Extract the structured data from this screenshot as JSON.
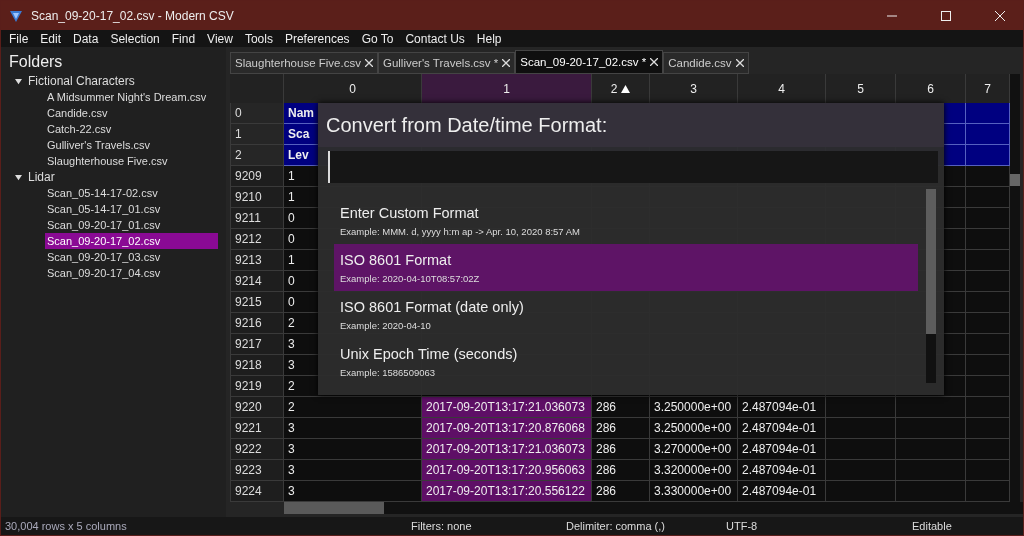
{
  "window": {
    "title": "Scan_09-20-17_02.csv - Modern CSV"
  },
  "menu": [
    "File",
    "Edit",
    "Data",
    "Selection",
    "Find",
    "View",
    "Tools",
    "Preferences",
    "Go To",
    "Contact Us",
    "Help"
  ],
  "sidebar": {
    "title": "Folders",
    "items": [
      {
        "label": "Fictional Characters",
        "expanded": true,
        "selected": false,
        "children": [
          {
            "label": "A Midsummer Night's Dream.csv",
            "selected": false
          },
          {
            "label": "Candide.csv",
            "selected": false
          },
          {
            "label": "Catch-22.csv",
            "selected": false
          },
          {
            "label": "Gulliver's Travels.csv",
            "selected": false
          },
          {
            "label": "Slaughterhouse Five.csv",
            "selected": false
          }
        ]
      },
      {
        "label": "Lidar",
        "expanded": true,
        "selected": false,
        "children": [
          {
            "label": "Scan_05-14-17-02.csv",
            "selected": false
          },
          {
            "label": "Scan_05-14-17_01.csv",
            "selected": false
          },
          {
            "label": "Scan_09-20-17_01.csv",
            "selected": false
          },
          {
            "label": "Scan_09-20-17_02.csv",
            "selected": true
          },
          {
            "label": "Scan_09-20-17_03.csv",
            "selected": false
          },
          {
            "label": "Scan_09-20-17_04.csv",
            "selected": false
          }
        ]
      }
    ]
  },
  "tabs": [
    {
      "label": "Slaughterhouse Five.csv",
      "selected": false
    },
    {
      "label": "Gulliver's Travels.csv *",
      "selected": false
    },
    {
      "label": "Scan_09-20-17_02.csv *",
      "selected": true
    },
    {
      "label": "Candide.csv",
      "selected": false
    }
  ],
  "table": {
    "columns": [
      {
        "label": "0",
        "sorted": false,
        "selected": false
      },
      {
        "label": "1",
        "sorted": false,
        "selected": true
      },
      {
        "label": "2",
        "sorted": true,
        "selected": false
      },
      {
        "label": "3",
        "sorted": false,
        "selected": false
      },
      {
        "label": "4",
        "sorted": false,
        "selected": false
      },
      {
        "label": "5",
        "sorted": false,
        "selected": false
      },
      {
        "label": "6",
        "sorted": false,
        "selected": false
      },
      {
        "label": "7",
        "sorted": false,
        "selected": false
      }
    ],
    "rows": [
      {
        "header": "0",
        "selected": true,
        "cells": [
          "Nam"
        ]
      },
      {
        "header": "1",
        "selected": true,
        "cells": [
          "Sca"
        ]
      },
      {
        "header": "2",
        "selected": true,
        "cells": [
          "Lev"
        ]
      },
      {
        "header": "9209",
        "selected": false,
        "cells": [
          "1"
        ]
      },
      {
        "header": "9210",
        "selected": false,
        "cells": [
          "1"
        ]
      },
      {
        "header": "9211",
        "selected": false,
        "cells": [
          "0"
        ]
      },
      {
        "header": "9212",
        "selected": false,
        "cells": [
          "0"
        ]
      },
      {
        "header": "9213",
        "selected": false,
        "cells": [
          "1"
        ]
      },
      {
        "header": "9214",
        "selected": false,
        "cells": [
          "0"
        ]
      },
      {
        "header": "9215",
        "selected": false,
        "cells": [
          "0"
        ]
      },
      {
        "header": "9216",
        "selected": false,
        "cells": [
          "2"
        ]
      },
      {
        "header": "9217",
        "selected": false,
        "cells": [
          "3"
        ]
      },
      {
        "header": "9218",
        "selected": false,
        "cells": [
          "3"
        ]
      },
      {
        "header": "9219",
        "selected": false,
        "cells": [
          "2"
        ]
      },
      {
        "header": "9220",
        "selected": false,
        "cells": [
          "2",
          "2017-09-20T13:17:21.036073",
          "286",
          "3.250000e+00",
          "2.487094e-01"
        ]
      },
      {
        "header": "9221",
        "selected": false,
        "cells": [
          "3",
          "2017-09-20T13:17:20.876068",
          "286",
          "3.250000e+00",
          "2.487094e-01"
        ]
      },
      {
        "header": "9222",
        "selected": false,
        "cells": [
          "3",
          "2017-09-20T13:17:21.036073",
          "286",
          "3.270000e+00",
          "2.487094e-01"
        ]
      },
      {
        "header": "9223",
        "selected": false,
        "cells": [
          "3",
          "2017-09-20T13:17:20.956063",
          "286",
          "3.320000e+00",
          "2.487094e-01"
        ]
      },
      {
        "header": "9224",
        "selected": false,
        "cells": [
          "3",
          "2017-09-20T13:17:20.556122",
          "286",
          "3.330000e+00",
          "2.487094e-01"
        ]
      }
    ]
  },
  "dialog": {
    "title": "Convert from Date/time Format:",
    "options": [
      {
        "name": "Enter Custom Format",
        "example": "Example: MMM. d, yyyy h:m ap -> Apr. 10, 2020 8:57 AM",
        "selected": false
      },
      {
        "name": "ISO 8601 Format",
        "example": "Example: 2020-04-10T08:57:02Z",
        "selected": true
      },
      {
        "name": "ISO 8601 Format (date only)",
        "example": "Example: 2020-04-10",
        "selected": false
      },
      {
        "name": "Unix Epoch Time (seconds)",
        "example": "Example: 1586509063",
        "selected": false
      }
    ]
  },
  "status_bar": {
    "size": "30,004 rows x 5 columns",
    "filters": "Filters: none",
    "delimiter": "Delimiter: comma (,)",
    "encoding": "UTF-8",
    "mode": "Editable"
  }
}
